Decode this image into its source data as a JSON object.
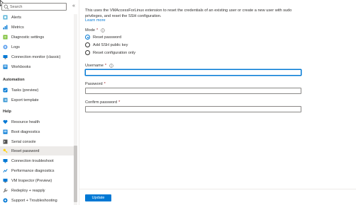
{
  "sidebar": {
    "search_placeholder": "Search",
    "collapse_glyph": "«",
    "items_top": [
      {
        "label": "Alerts",
        "icon": "alerts-icon"
      },
      {
        "label": "Metrics",
        "icon": "metrics-icon"
      },
      {
        "label": "Diagnostic settings",
        "icon": "diagnostic-settings-icon"
      },
      {
        "label": "Logs",
        "icon": "logs-icon"
      },
      {
        "label": "Connection monitor (classic)",
        "icon": "connection-monitor-icon"
      },
      {
        "label": "Workbooks",
        "icon": "workbooks-icon"
      }
    ],
    "automation_header": "Automation",
    "automation_items": [
      {
        "label": "Tasks (preview)",
        "icon": "tasks-icon"
      },
      {
        "label": "Export template",
        "icon": "export-template-icon"
      }
    ],
    "help_header": "Help",
    "help_items": [
      {
        "label": "Resource health",
        "icon": "heart-icon"
      },
      {
        "label": "Boot diagnostics",
        "icon": "boot-diagnostics-icon"
      },
      {
        "label": "Serial console",
        "icon": "serial-console-icon"
      },
      {
        "label": "Reset password",
        "icon": "key-icon",
        "selected": true
      },
      {
        "label": "Connection troubleshoot",
        "icon": "connection-troubleshoot-icon"
      },
      {
        "label": "Performance diagnostics",
        "icon": "performance-diagnostics-icon"
      },
      {
        "label": "VM Inspector (Preview)",
        "icon": "vm-inspector-icon"
      },
      {
        "label": "Redeploy + reapply",
        "icon": "wrench-icon"
      },
      {
        "label": "Support + Troubleshooting",
        "icon": "support-icon"
      }
    ]
  },
  "main": {
    "description": "This uses the VMAccessForLinux extension to reset the credentials of an existing user or create a new user with sudo privileges, and reset the SSH configuration.",
    "learn_more": "Learn more",
    "mode_label": "Mode",
    "required_mark": "*",
    "mode_options": [
      {
        "label": "Reset password",
        "checked": true
      },
      {
        "label": "Add SSH public key",
        "checked": false
      },
      {
        "label": "Reset configuration only",
        "checked": false
      }
    ],
    "username_label": "Username",
    "username_value": "",
    "password_label": "Password",
    "password_value": "",
    "confirm_password_label": "Confirm password",
    "confirm_password_value": "",
    "update_button": "Update"
  },
  "colors": {
    "accent": "#0078d4",
    "required": "#a4262c",
    "selected_row": "#edebe9"
  }
}
